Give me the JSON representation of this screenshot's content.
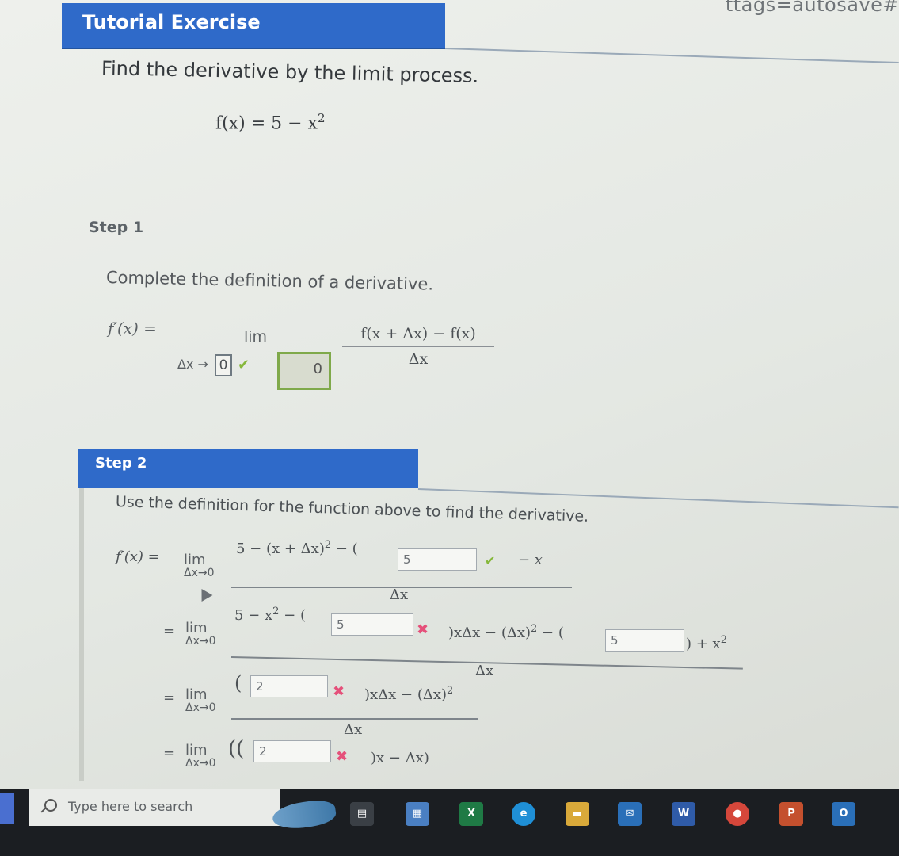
{
  "browser": {
    "url_fragment": "ttags=autosave#"
  },
  "header": {
    "title": "Tutorial Exercise"
  },
  "problem": {
    "instruction": "Find the derivative by the limit process.",
    "function_lhs": "f(x) = 5 − x",
    "function_exp": "2"
  },
  "step1": {
    "label": "Step 1",
    "instruction": "Complete the definition of a derivative.",
    "lhs": "f′(x) =",
    "lim": "lim",
    "sub_prefix": "Δx →",
    "sub_value": "0",
    "box_value": "0",
    "numerator": "f(x + Δx) − f(x)",
    "denominator": "Δx"
  },
  "step2": {
    "label": "Step 2",
    "instruction": "Use the definition for the function above to find the derivative.",
    "lhs": "f′(x) =",
    "eq": "=",
    "lim": "lim",
    "lim_sub": "Δx→0",
    "row1": {
      "num_left": "5 − (x + Δx)",
      "exp": "2",
      "num_mid": " − (",
      "input_value": "5",
      "num_right": "− x",
      "den": "Δx"
    },
    "row2": {
      "num_left": "5 − x",
      "exp": "2",
      "open": " − (",
      "input1": "5",
      "mid": ")xΔx − (Δx)",
      "mid_exp": "2",
      "open2": " − (",
      "input2": "5",
      "end": ") + x",
      "end_exp": "2",
      "den": "Δx"
    },
    "row3": {
      "open": "(",
      "input": "2",
      "mid": ")xΔx − (Δx)",
      "mid_exp": "2",
      "den": "Δx"
    },
    "row4": {
      "open": "((",
      "input": "2",
      "mid": ")x − Δx)"
    }
  },
  "taskbar": {
    "search_placeholder": "Type here to search",
    "icons": [
      "task-view-icon",
      "store-icon",
      "excel-icon",
      "edge-icon",
      "files-icon",
      "mail-icon",
      "word-icon",
      "chrome-icon",
      "powerpoint-icon",
      "outlook-icon"
    ]
  }
}
